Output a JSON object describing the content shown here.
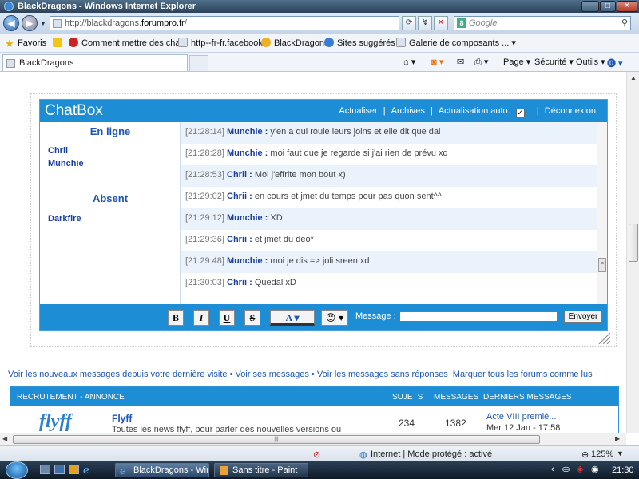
{
  "window": {
    "title": "BlackDragons - Windows Internet Explorer",
    "buttons": [
      "–",
      "□",
      "✕"
    ]
  },
  "address": {
    "prefix": "http://blackdragons.",
    "domain": "forumpro.fr",
    "suffix": "/",
    "search_placeholder": "Google"
  },
  "favorites": {
    "label": "Favoris",
    "items": [
      "Comment mettre des cha...",
      "http--fr-fr.facebook",
      "BlackDragons",
      "Sites suggérés ▾",
      "Galerie de composants ... ▾"
    ]
  },
  "tab": {
    "title": "BlackDragons"
  },
  "commands": [
    "Page ▾",
    "Sécurité ▾",
    "Outils ▾"
  ],
  "chatbox": {
    "title": "ChatBox",
    "links": [
      "Actualiser",
      "|",
      "Archives",
      "|",
      "Actualisation auto.",
      "|",
      "Déconnexion"
    ],
    "auto_refresh_checked": "✓",
    "groups": [
      {
        "label": "En ligne",
        "users": [
          "Chrii",
          "Munchie"
        ]
      },
      {
        "label": "Absent",
        "users": [
          "Darkfire"
        ]
      }
    ],
    "messages": [
      {
        "time": "[21:28:14]",
        "user": "Munchie",
        "text": "y'en a qui roule leurs joins et elle dit que dal"
      },
      {
        "time": "[21:28:28]",
        "user": "Munchie",
        "text": "moi faut que je regarde si j'ai rien de prévu xd"
      },
      {
        "time": "[21:28:53]",
        "user": "Chrii",
        "text": "Moi j'effrite mon bout x)"
      },
      {
        "time": "[21:29:02]",
        "user": "Chrii",
        "text": "en cours et jmet du temps pour pas quon sent^^"
      },
      {
        "time": "[21:29:12]",
        "user": "Munchie",
        "text": "XD"
      },
      {
        "time": "[21:29:36]",
        "user": "Chrii",
        "text": "et jmet du deo*"
      },
      {
        "time": "[21:29:48]",
        "user": "Munchie",
        "text": "moi je dis => joli sreen xd"
      },
      {
        "time": "[21:30:03]",
        "user": "Chrii",
        "text": "Quedal xD"
      }
    ],
    "separator": " : ",
    "toolbar": {
      "bold": "B",
      "italic": "I",
      "underline": "U",
      "strike": "S",
      "color": "A ▾",
      "emoji": "☺ ▾"
    },
    "message_label": "Message :",
    "send_label": "Envoyer"
  },
  "forum": {
    "links": [
      "Voir les nouveaux messages depuis votre dernière visite",
      "•",
      "Voir ses messages",
      "•",
      "Voir les messages sans réponses",
      "Marquer tous les forums comme lus"
    ],
    "headers": {
      "category": "RECRUTEMENT - ANNONCE",
      "topics": "SUJETS",
      "posts": "MESSAGES",
      "last": "DERNIERS MESSAGES"
    },
    "row": {
      "logo": "flyff",
      "title": "Flyff",
      "description": "Toutes les news flyff, pour parler des nouvelles versions ou",
      "topics": "234",
      "posts": "1382",
      "last_title": "Acte VIII premiè...",
      "last_date": "Mer 12 Jan - 17:58"
    }
  },
  "status": {
    "zone": "Internet | Mode protégé : activé",
    "zoom": "125%"
  },
  "taskbar": {
    "items": [
      "BlackDragons - Win...",
      "Sans titre - Paint"
    ],
    "clock": "21:30"
  },
  "colors": {
    "accent": "#1d8ed6",
    "link": "#1d56b5",
    "user": "#1c3fa0"
  }
}
